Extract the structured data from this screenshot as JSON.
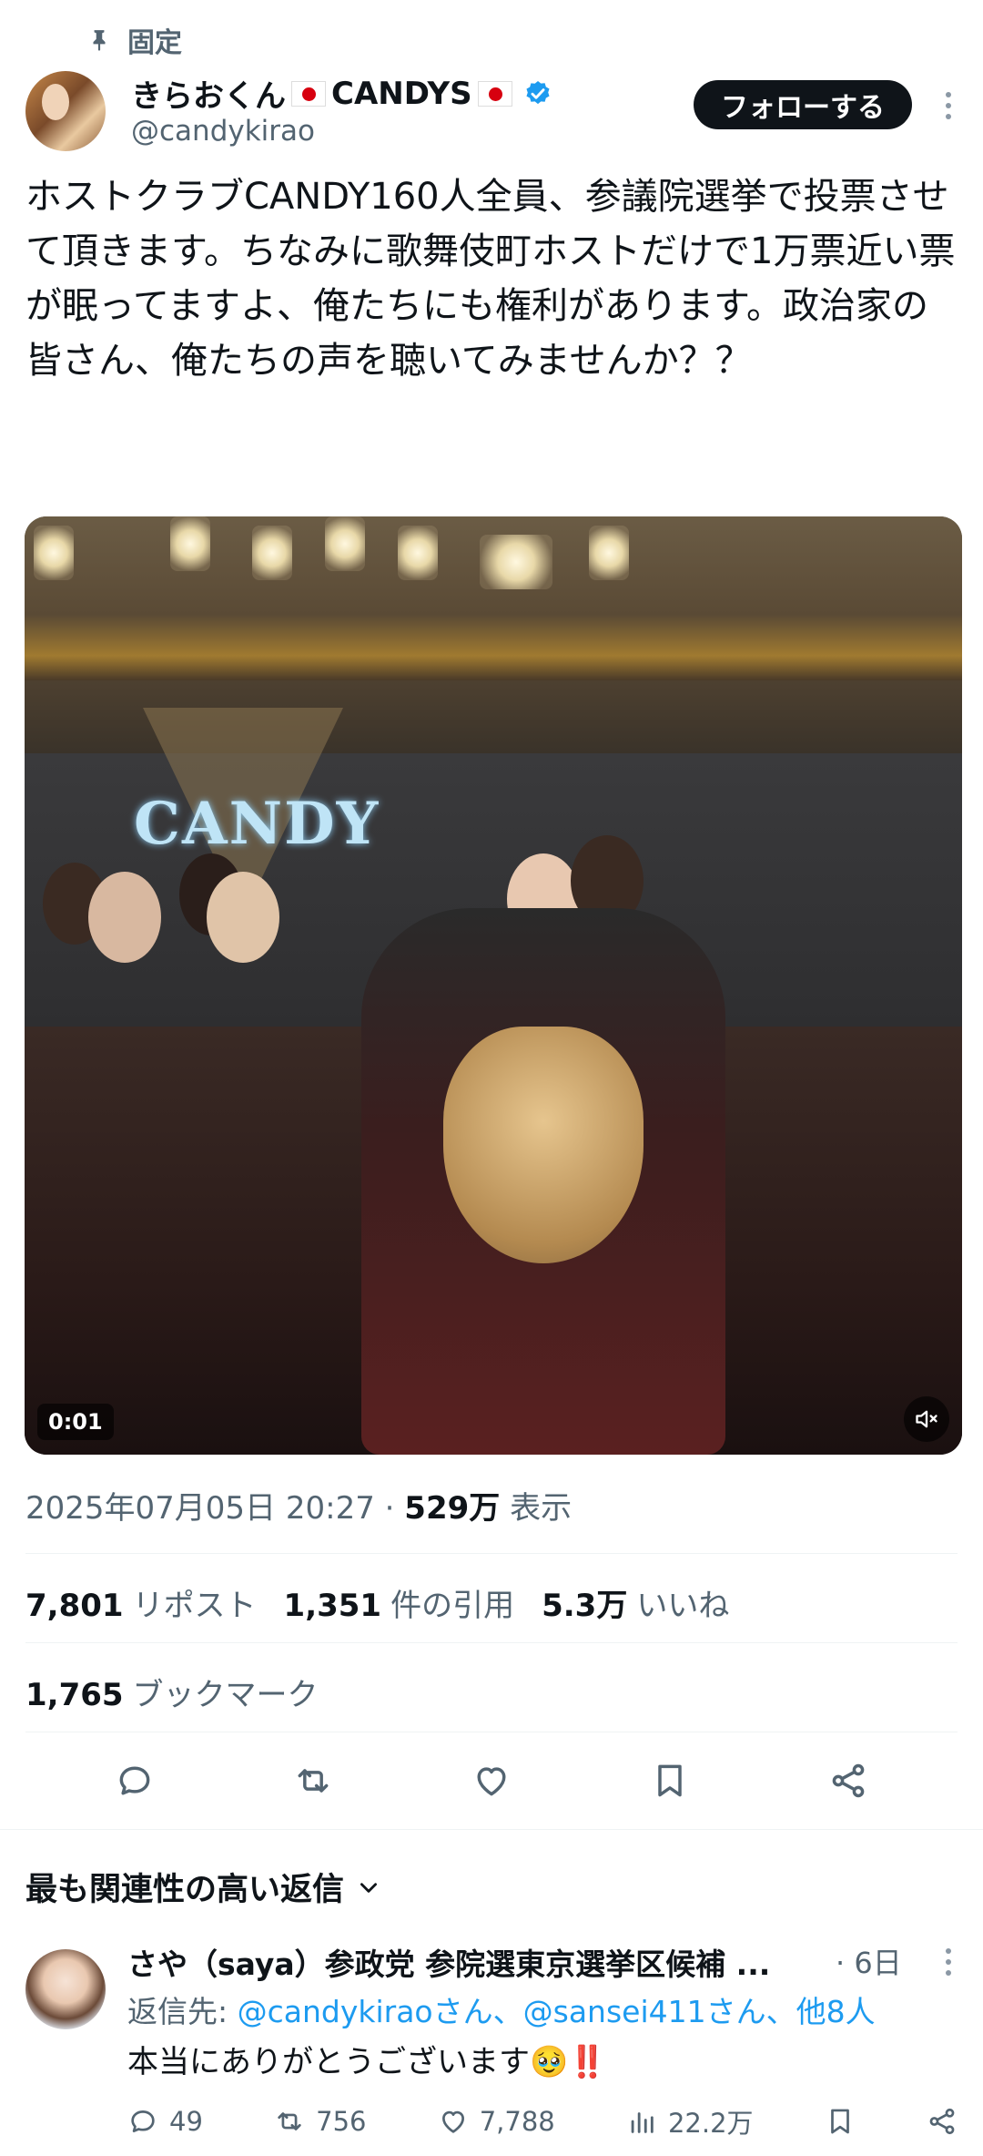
{
  "pinned_label": "固定",
  "author": {
    "name": "きらおくん",
    "name_suffix": "CANDYS",
    "handle": "@candykirao",
    "follow_label": "フォローする"
  },
  "tweet": {
    "text": "ホストクラブCANDY160人全員、参議院選挙で投票させて頂きます。ちなみに歌舞伎町ホストだけで1万票近い票が眠ってますよ、俺たちにも権利があります。政治家の皆さん、俺たちの声を聴いてみませんか？？",
    "media": {
      "sign_text": "CANDY",
      "video_time": "0:01"
    },
    "timestamp": "2025年07月05日 20:27",
    "separator": "·",
    "views_count": "529万",
    "views_label": "表示"
  },
  "stats": {
    "reposts_count": "7,801",
    "reposts_label": "リポスト",
    "quotes_count": "1,351",
    "quotes_label": "件の引用",
    "likes_count": "5.3万",
    "likes_label": "いいね",
    "bookmarks_count": "1,765",
    "bookmarks_label": "ブックマーク"
  },
  "replies_section": {
    "title": "最も関連性の高い返信"
  },
  "reply": {
    "name": "さや（saya）参政党 参院選東京選挙区候補 ...",
    "time": "· 6日",
    "reply_to_prefix": "返信先: ",
    "reply_to_links": "@candykiraoさん、@sansei411さん、他8人",
    "body": "本当にありがとうございます🥹‼️",
    "replies": "49",
    "reposts": "756",
    "likes": "7,788",
    "views": "22.2万"
  },
  "colors": {
    "accent": "#1d9bf0",
    "text": "#0f1419",
    "muted": "#536471",
    "divider": "#eff3f4"
  }
}
